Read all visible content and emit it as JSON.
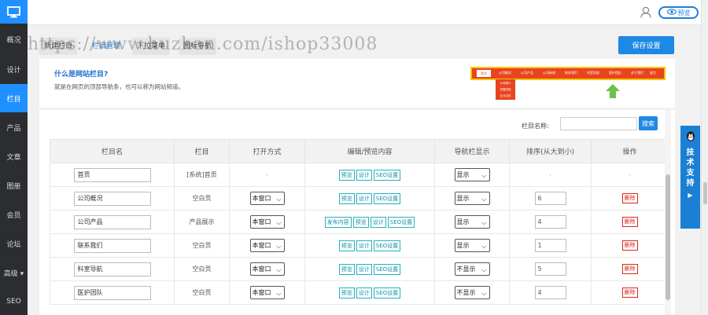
{
  "sidebar": {
    "items": [
      {
        "label": "概况"
      },
      {
        "label": "设计"
      },
      {
        "label": "栏目"
      },
      {
        "label": "产品"
      },
      {
        "label": "文章"
      },
      {
        "label": "图册"
      },
      {
        "label": "会员"
      },
      {
        "label": "论坛"
      },
      {
        "label": "高级 ▾"
      },
      {
        "label": "SEO"
      }
    ],
    "active_index": 2
  },
  "header": {
    "preview_label": "预览"
  },
  "tabs": [
    {
      "label": "新建栏目"
    },
    {
      "label": "栏目管理"
    },
    {
      "label": "下拉菜单"
    },
    {
      "label": "图标导航"
    }
  ],
  "save_label": "保存设置",
  "watermark": "https://www.huzhan.com/ishop33008",
  "info": {
    "title": "什么是网站栏目?",
    "desc": "就是在网页的顶部导航条，也可以称为网站频道。",
    "demo_home": "首页",
    "demo_items": [
      "公司概况",
      "公司产品",
      "公司新闻",
      "联系我们",
      "科室导航",
      "医护团队",
      "关于我们",
      "留言"
    ],
    "demo_sub": [
      "公司简介",
      "发展历程",
      "企业文化"
    ]
  },
  "search": {
    "label": "栏目名称:",
    "button": "搜索",
    "value": ""
  },
  "table": {
    "headers": [
      "栏目名",
      "栏目",
      "打开方式",
      "编辑/预览内容",
      "导航栏显示",
      "排序(从大到小)",
      "操作"
    ],
    "rows": [
      {
        "name": "首页",
        "type": "[系统]首页",
        "open": "-",
        "actions": [
          "预览",
          "设计",
          "SEO设置"
        ],
        "nav": "显示",
        "order": "-",
        "op": "-"
      },
      {
        "name": "公司概况",
        "type": "空白页",
        "open": "本窗口",
        "actions": [
          "预览",
          "设计",
          "SEO设置"
        ],
        "nav": "显示",
        "order": "6",
        "op": "删除"
      },
      {
        "name": "公司产品",
        "type": "产品展示",
        "open": "本窗口",
        "actions": [
          "发布内容",
          "预览",
          "设计",
          "SEO设置"
        ],
        "nav": "显示",
        "order": "4",
        "op": "删除"
      },
      {
        "name": "联系我们",
        "type": "空白页",
        "open": "本窗口",
        "actions": [
          "预览",
          "设计",
          "SEO设置"
        ],
        "nav": "显示",
        "order": "1",
        "op": "删除"
      },
      {
        "name": "科室导航",
        "type": "空白页",
        "open": "本窗口",
        "actions": [
          "预览",
          "设计",
          "SEO设置"
        ],
        "nav": "不显示",
        "order": "5",
        "op": "删除"
      },
      {
        "name": "医护团队",
        "type": "空白页",
        "open": "本窗口",
        "actions": [
          "预览",
          "设计",
          "SEO设置"
        ],
        "nav": "不显示",
        "order": "4",
        "op": "删除"
      }
    ]
  },
  "support": {
    "label": "技术支持",
    "arrow": "▶"
  },
  "colors": {
    "accent": "#1e88e5",
    "sidebar_bg": "#2b2d31",
    "demo_nav": "#e8441f",
    "delete": "#d9281d"
  }
}
